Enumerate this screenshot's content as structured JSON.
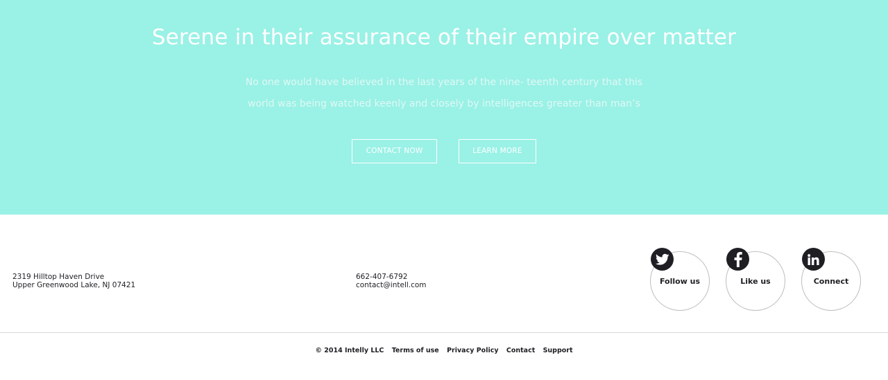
{
  "hero": {
    "title": "Serene in their assurance of their empire over matter",
    "text_line1": "No one would have believed in the last years of the nine- teenth century that this",
    "text_line2": "world was being watched keenly and closely by intelligences greater than man’s",
    "contact_button": "CONTACT NOW",
    "learn_button": "LEARN MORE",
    "background_color": "#9af1e6"
  },
  "footer": {
    "address_line1": "2319 Hilltop Haven Drive",
    "address_line2": "Upper Greenwood Lake, NJ 07421",
    "phone": "662-407-6792",
    "email": "contact@intell.com",
    "social": [
      {
        "label": "Follow us",
        "icon": "twitter-icon"
      },
      {
        "label": "Like us",
        "icon": "facebook-icon"
      },
      {
        "label": "Connect",
        "icon": "linkedin-icon"
      }
    ]
  },
  "bottom": {
    "copyright": "© 2014 Intelly LLC",
    "links": [
      "Terms of use",
      "Privacy Policy",
      "Contact",
      "Support"
    ]
  }
}
